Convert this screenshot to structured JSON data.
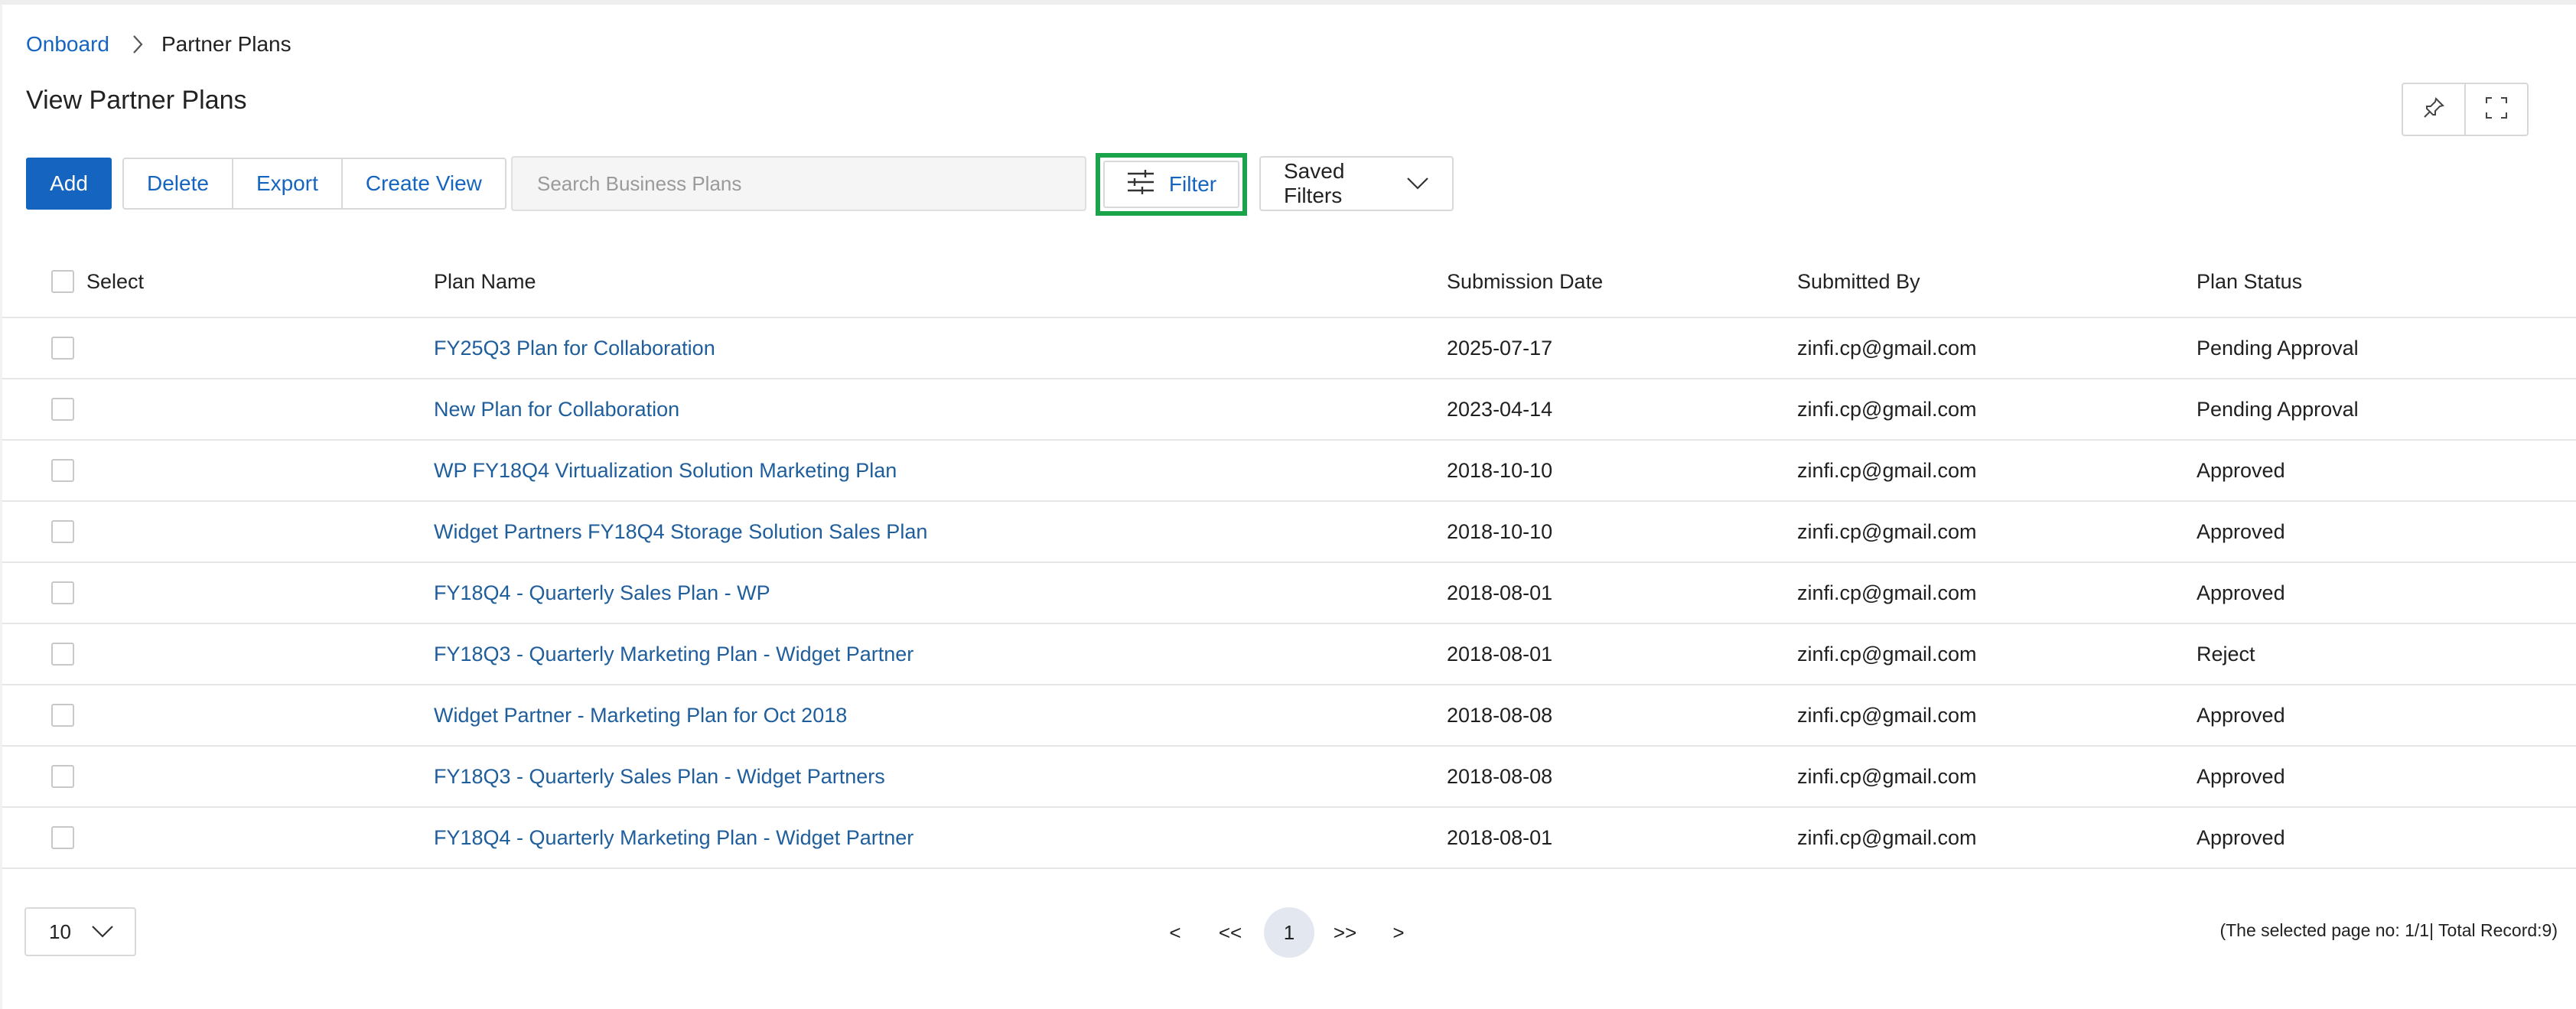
{
  "breadcrumb": {
    "root": "Onboard",
    "current": "Partner Plans"
  },
  "page": {
    "title": "View Partner Plans"
  },
  "toolbar": {
    "add_label": "Add",
    "delete_label": "Delete",
    "export_label": "Export",
    "create_view_label": "Create View",
    "search_placeholder": "Search Business Plans",
    "filter_label": "Filter",
    "saved_filters_label": "Saved Filters",
    "icons": [
      "pin-icon",
      "fullscreen-icon",
      "sliders-icon",
      "chevron-down-icon"
    ]
  },
  "highlight_color": "#1aa34a",
  "accent_color": "#1565c0",
  "table": {
    "headers": {
      "select": "Select",
      "plan_name": "Plan Name",
      "submission_date": "Submission Date",
      "submitted_by": "Submitted By",
      "plan_status": "Plan Status"
    },
    "rows": [
      {
        "name": "FY25Q3 Plan for Collaboration",
        "date": "2025-07-17",
        "by": "zinfi.cp@gmail.com",
        "status": "Pending Approval"
      },
      {
        "name": "New Plan for Collaboration",
        "date": "2023-04-14",
        "by": "zinfi.cp@gmail.com",
        "status": "Pending Approval"
      },
      {
        "name": "WP FY18Q4 Virtualization Solution Marketing Plan",
        "date": "2018-10-10",
        "by": "zinfi.cp@gmail.com",
        "status": "Approved"
      },
      {
        "name": "Widget Partners FY18Q4 Storage Solution Sales Plan",
        "date": "2018-10-10",
        "by": "zinfi.cp@gmail.com",
        "status": "Approved"
      },
      {
        "name": "FY18Q4 - Quarterly Sales Plan - WP",
        "date": "2018-08-01",
        "by": "zinfi.cp@gmail.com",
        "status": "Approved"
      },
      {
        "name": "FY18Q3 - Quarterly Marketing Plan - Widget Partner",
        "date": "2018-08-01",
        "by": "zinfi.cp@gmail.com",
        "status": "Reject"
      },
      {
        "name": "Widget Partner - Marketing Plan for Oct 2018",
        "date": "2018-08-08",
        "by": "zinfi.cp@gmail.com",
        "status": "Approved"
      },
      {
        "name": "FY18Q3 - Quarterly Sales Plan - Widget Partners",
        "date": "2018-08-08",
        "by": "zinfi.cp@gmail.com",
        "status": "Approved"
      },
      {
        "name": "FY18Q4 - Quarterly Marketing Plan - Widget Partner",
        "date": "2018-08-01",
        "by": "zinfi.cp@gmail.com",
        "status": "Approved"
      }
    ]
  },
  "pagination": {
    "page_size": "10",
    "prev": "<",
    "first": "<<",
    "current": "1",
    "last": ">>",
    "next": ">",
    "record_info": "(The selected page no: 1/1| Total Record:9)"
  }
}
